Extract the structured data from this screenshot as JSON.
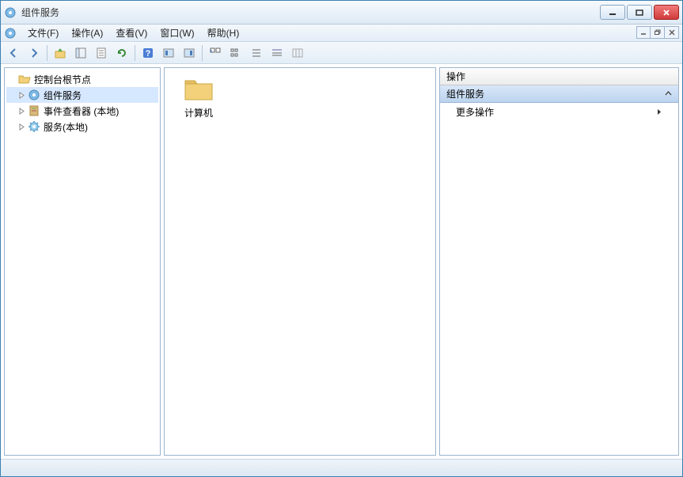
{
  "window": {
    "title": "组件服务"
  },
  "menu": {
    "items": [
      "文件(F)",
      "操作(A)",
      "查看(V)",
      "窗口(W)",
      "帮助(H)"
    ]
  },
  "tree": {
    "root": {
      "label": "控制台根节点"
    },
    "children": [
      {
        "label": "组件服务",
        "icon": "svc"
      },
      {
        "label": "事件查看器 (本地)",
        "icon": "event"
      },
      {
        "label": "服务(本地)",
        "icon": "gear"
      }
    ]
  },
  "content": {
    "items": [
      {
        "label": "计算机",
        "icon": "folder"
      }
    ]
  },
  "actions": {
    "header": "操作",
    "section": "组件服务",
    "rows": [
      "更多操作"
    ]
  }
}
